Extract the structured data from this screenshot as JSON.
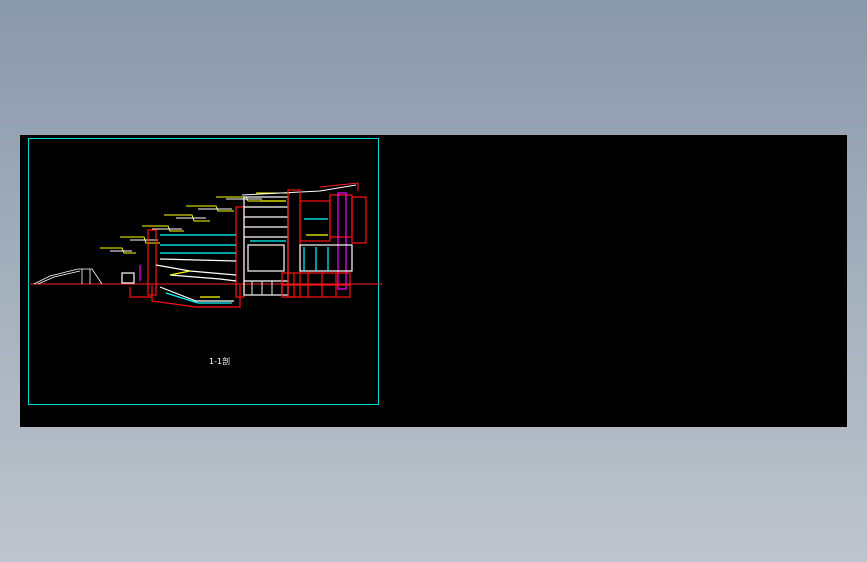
{
  "canvas": {
    "background_color": "#000000",
    "app_background_top": "#8a98ab",
    "app_background_bottom": "#bdc4cc"
  },
  "drawing": {
    "label": "1-1剖",
    "colors": {
      "frame": "#00d8d8",
      "ground": "#ff2020",
      "structure": "#ff1010",
      "white": "#ffffff",
      "yellow": "#ffff00",
      "cyan": "#00ffff",
      "magenta": "#ff00ff",
      "grey": "#c8c8c8"
    }
  }
}
